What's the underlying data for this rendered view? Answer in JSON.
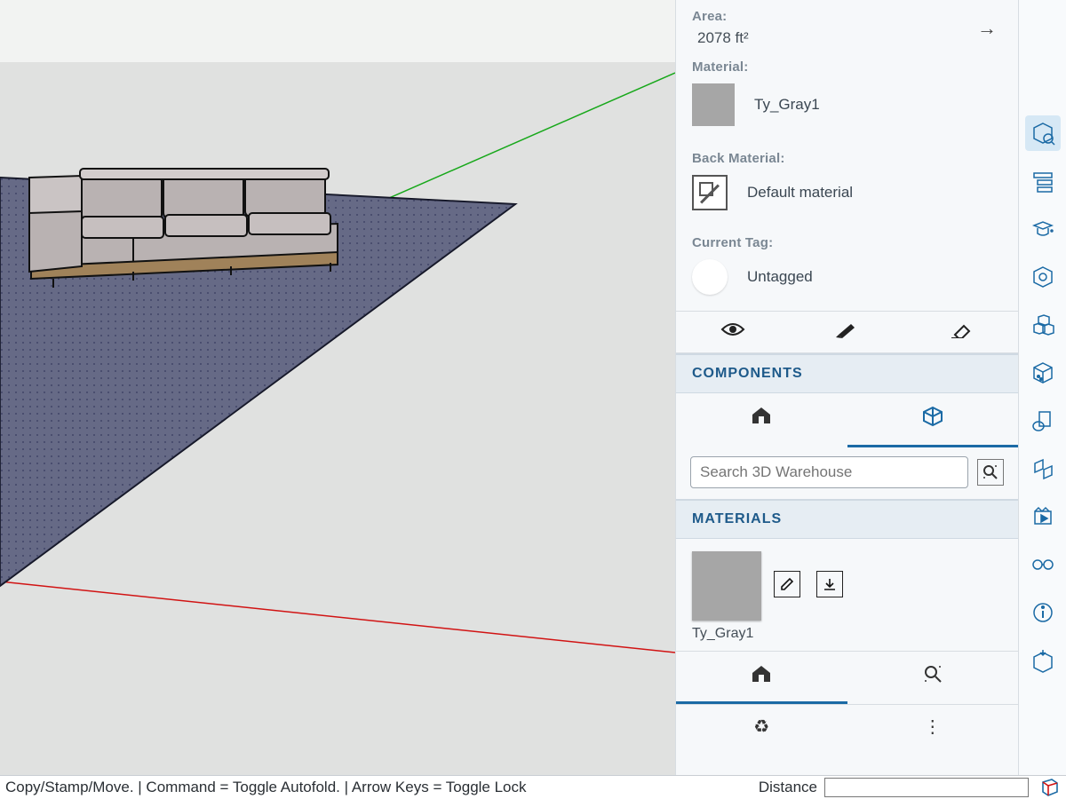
{
  "entity": {
    "area_label": "Area:",
    "area_value": "2078 ft²",
    "material_label": "Material:",
    "material_value": "Ty_Gray1",
    "material_swatch_color": "#a6a6a6",
    "back_material_label": "Back Material:",
    "back_material_value": "Default material",
    "tag_label": "Current Tag:",
    "tag_value": "Untagged"
  },
  "sections": {
    "components": "COMPONENTS",
    "materials": "MATERIALS"
  },
  "search": {
    "placeholder": "Search 3D Warehouse"
  },
  "material_card": {
    "name": "Ty_Gray1",
    "swatch_color": "#a6a6a6"
  },
  "status": {
    "hint": "Copy/Stamp/Move. | Command = Toggle Autofold. | Arrow Keys = Toggle Lock",
    "distance_label": "Distance",
    "distance_value": ""
  },
  "rail_icons": [
    "entity-info-icon",
    "outliner-icon",
    "instructor-icon",
    "tags-icon",
    "components-icon",
    "materials-icon",
    "styles-icon",
    "display-icon",
    "scenes-icon",
    "views-icon",
    "info-icon",
    "warehouse-icon"
  ]
}
